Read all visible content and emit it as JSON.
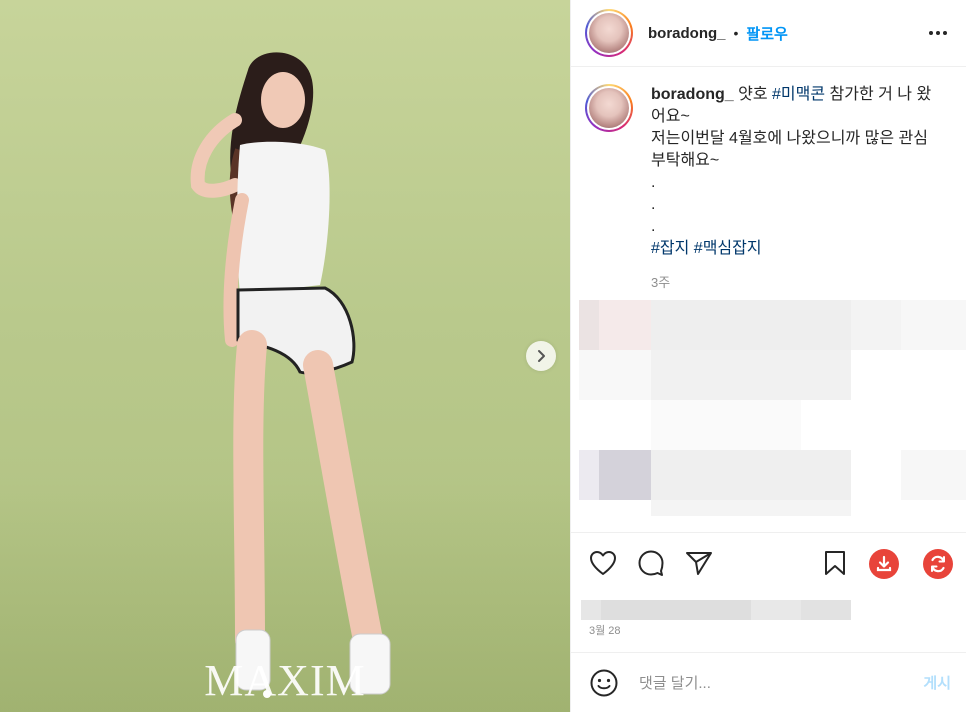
{
  "post": {
    "media": {
      "watermark": "MAXIM"
    },
    "header": {
      "username": "boradong_",
      "separator": "•",
      "follow_label": "팔로우"
    },
    "caption": {
      "username": "boradong_",
      "line1_prefix": " 얏호 ",
      "line1_tag": "#미맥콘",
      "line1_suffix": " 참가한 거 나 왔어요~",
      "line2": "저는이번달 4월호에 나왔으니까 많은 관심 부탁해요~",
      "dots": [
        ".",
        ".",
        "."
      ],
      "tag1": "#잡지",
      "tag2": "#맥심잡지",
      "time": "3주"
    },
    "actions": {
      "like_icon": "heart-icon",
      "comment_icon": "comment-icon",
      "share_icon": "send-icon",
      "save_icon": "bookmark-icon",
      "download_icon": "download-icon",
      "repost_icon": "refresh-icon"
    },
    "date": "3월 28",
    "comment": {
      "placeholder": "댓글 달기...",
      "post_label": "게시",
      "emoji_icon": "emoji-icon"
    },
    "colors": {
      "link": "#0095f6",
      "hashtag": "#00376b",
      "muted": "#8e8e8e",
      "accent_red": "#e8443a",
      "post_disabled": "#b2dffc"
    }
  }
}
